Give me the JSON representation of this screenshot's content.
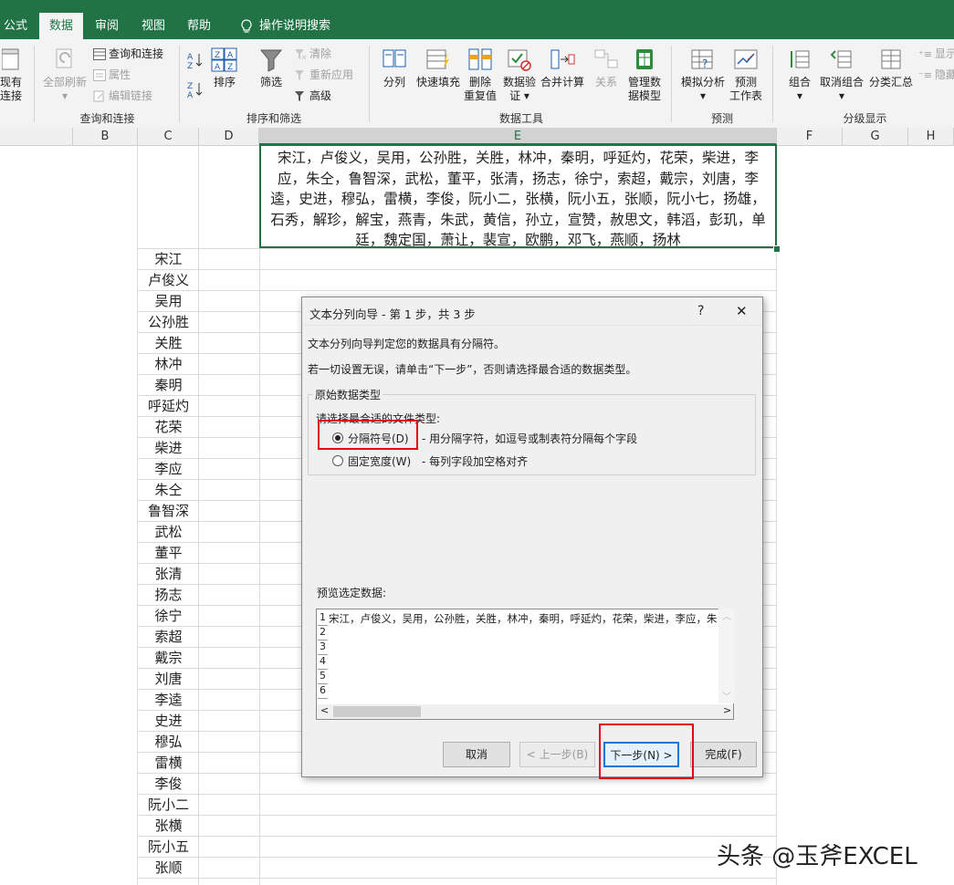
{
  "ribbon_tabs": [
    {
      "label": "公式",
      "active": false
    },
    {
      "label": "数据",
      "active": true
    },
    {
      "label": "审阅",
      "active": false
    },
    {
      "label": "视图",
      "active": false
    },
    {
      "label": "帮助",
      "active": false
    },
    {
      "label": "操作说明搜索",
      "active": false
    }
  ],
  "ribbon": {
    "left_partial": {
      "line1": "现有",
      "line2": "连接"
    },
    "refresh_all": "全部刷新",
    "queries_connections": "查询和连接",
    "properties": "属性",
    "edit_links": "编辑链接",
    "group_query": "查询和连接",
    "sort": "排序",
    "filter": "筛选",
    "clear": "清除",
    "reapply": "重新应用",
    "advanced": "高级",
    "group_sort": "排序和筛选",
    "text_to_columns": "分列",
    "flash_fill": "快速填充",
    "remove_dup": {
      "line1": "删除",
      "line2": "重复值"
    },
    "data_validation": {
      "line1": "数据验",
      "line2": "证"
    },
    "consolidate": "合并计算",
    "relationships": "关系",
    "data_model": {
      "line1": "管理数",
      "line2": "据模型"
    },
    "group_tools": "数据工具",
    "what_if": "模拟分析",
    "forecast": {
      "line1": "预测",
      "line2": "工作表"
    },
    "group_forecast": "预测",
    "group_btn": "组合",
    "ungroup": "取消组合",
    "subtotal": "分类汇总",
    "show_detail": "显示",
    "hide_detail": "隐藏",
    "group_outline": "分级显示"
  },
  "columns": [
    "B",
    "C",
    "D",
    "E",
    "F",
    "G",
    "H"
  ],
  "cell_e1": "宋江，卢俊义，吴用，公孙胜，关胜，林冲，秦明，呼延灼，花荣，柴进，李应，朱仝，鲁智深，武松，董平，张清，扬志，徐宁，索超，戴宗，刘唐，李逵，史进，穆弘，雷横，李俊，阮小二，张横，阮小五，张顺，阮小七，扬雄，石秀，解珍，解宝，燕青，朱武，黄信，孙立，宣赞，赦思文，韩滔，彭玑，单廷，魏定国，萧让，裴宣，欧鹏，邓飞，燕顺，扬林",
  "names": [
    "宋江",
    "卢俊义",
    "吴用",
    "公孙胜",
    "关胜",
    "林冲",
    "秦明",
    "呼延灼",
    "花荣",
    "柴进",
    "李应",
    "朱仝",
    "鲁智深",
    "武松",
    "董平",
    "张清",
    "扬志",
    "徐宁",
    "索超",
    "戴宗",
    "刘唐",
    "李逵",
    "史进",
    "穆弘",
    "雷横",
    "李俊",
    "阮小二",
    "张横",
    "阮小五",
    "张顺"
  ],
  "dialog": {
    "title": "文本分列向导 - 第 1 步，共 3 步",
    "help": "?",
    "close": "✕",
    "line1": "文本分列向导判定您的数据具有分隔符。",
    "line2": "若一切设置无误，请单击“下一步”，否则请选择最合适的数据类型。",
    "group_title": "原始数据类型",
    "prompt": "请选择最合适的文件类型:",
    "option_delimited": "分隔符号(D)",
    "option_delimited_desc": "- 用分隔字符，如逗号或制表符分隔每个字段",
    "option_fixed": "固定宽度(W)",
    "option_fixed_desc": "- 每列字段加空格对齐",
    "selected_option": "delimited",
    "preview_label": "预览选定数据:",
    "preview_line1": "宋江，卢俊义，吴用，公孙胜，关胜，林冲，秦明，呼延灼，花荣，柴进，李应，朱",
    "preview_line_numbers": [
      "1",
      "2",
      "3",
      "4",
      "5",
      "6"
    ],
    "cancel": "取消",
    "back": "< 上一步(B)",
    "next": "下一步(N) >",
    "finish": "完成(F)"
  },
  "watermark": "头条 @玉斧EXCEL",
  "colors": {
    "excel_green": "#217346",
    "highlight_red": "#e60012",
    "focus_blue": "#0078d7"
  }
}
